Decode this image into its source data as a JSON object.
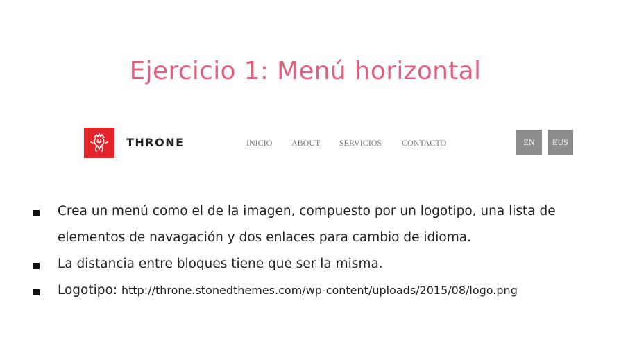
{
  "title": "Ejercicio 1: Menú horizontal",
  "example_nav": {
    "logo_icon": "red-square-heraldic-lion-logo",
    "brand": "THRONE",
    "menu": [
      "INICIO",
      "ABOUT",
      "SERVICIOS",
      "CONTACTO"
    ],
    "languages": [
      "EN",
      "EUS"
    ],
    "colors": {
      "logo_bg": "#e3252b",
      "lang_bg": "#8c8c8c",
      "menu_text": "#777777"
    }
  },
  "bullets": [
    "Crea un menú como el de la imagen, compuesto por un logotipo, una lista de elementos de navagación y dos enlaces para cambio de idioma.",
    "La distancia entre bloques tiene que ser la misma."
  ],
  "logo_item": {
    "label": "Logotipo: ",
    "url": "http://throne.stonedthemes.com/wp-content/uploads/2015/08/logo.png"
  },
  "accent_color": "#e0607e"
}
